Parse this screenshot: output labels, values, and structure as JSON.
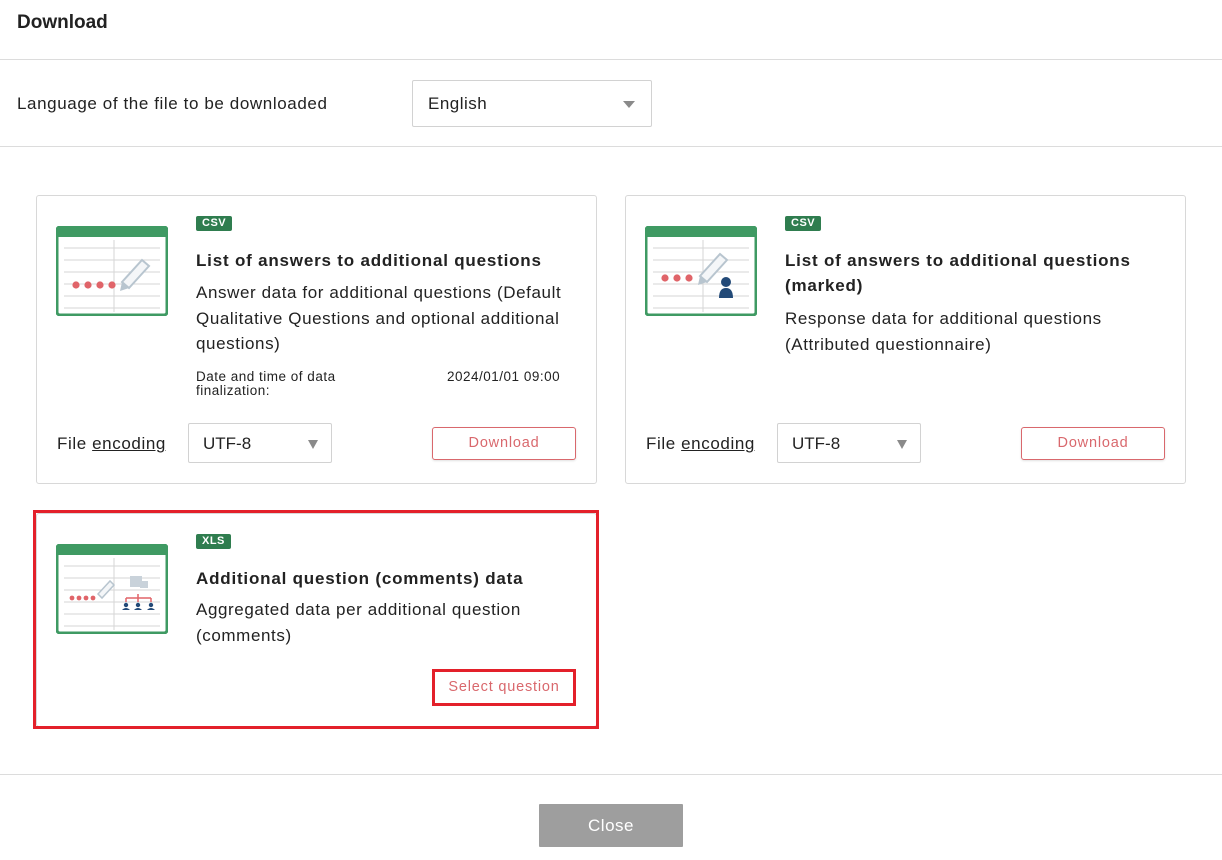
{
  "header": {
    "title": "Download"
  },
  "language": {
    "label": "Language of the file to be downloaded",
    "selected": "English"
  },
  "cards": [
    {
      "badge": "CSV",
      "title": "List of answers to additional questions",
      "description": "Answer data for additional questions (Default Qualitative Questions and optional additional questions)",
      "date_label": "Date and time of data finalization:",
      "date_value": "2024/01/01 09:00",
      "encoding_prefix": "File ",
      "encoding_link": "encoding",
      "encoding_value": "UTF-8",
      "action_label": "Download",
      "icon": "spreadsheet-edit-icon"
    },
    {
      "badge": "CSV",
      "title": "List of answers to additional questions (marked)",
      "description": "Response data for additional questions (Attributed questionnaire)",
      "encoding_prefix": "File ",
      "encoding_link": "encoding",
      "encoding_value": "UTF-8",
      "action_label": "Download",
      "icon": "spreadsheet-person-icon"
    },
    {
      "badge": "XLS",
      "title": "Additional question (comments) data",
      "description": "Aggregated data per additional question (comments)",
      "action_label": "Select question",
      "icon": "spreadsheet-hierarchy-icon"
    }
  ],
  "footer": {
    "close_label": "Close"
  },
  "colors": {
    "accent_red": "#d9686d",
    "highlight_red": "#e3202a",
    "badge_green": "#2f7d4f",
    "close_gray": "#9e9e9e"
  }
}
